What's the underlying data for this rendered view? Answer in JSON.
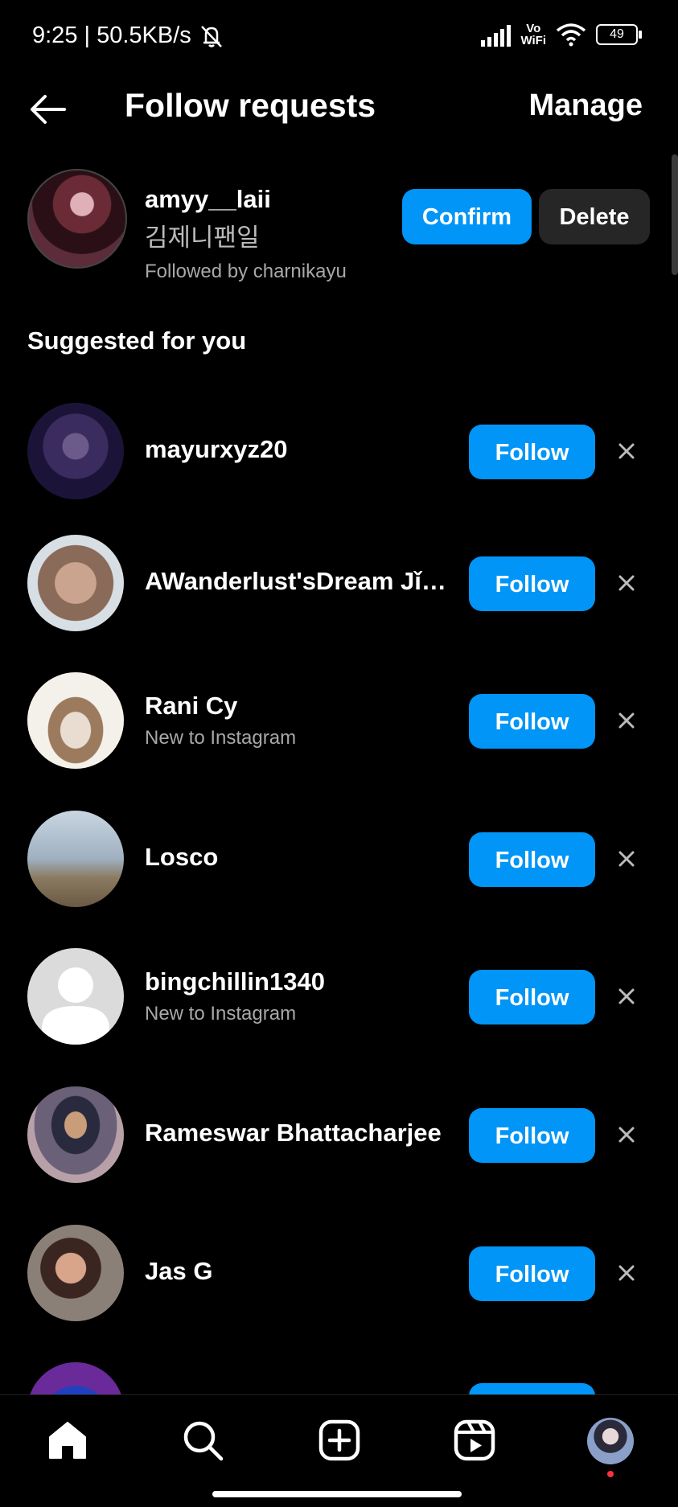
{
  "status_bar": {
    "time_speed": "9:25 | 50.5KB/s",
    "vowifi_top": "Vo",
    "vowifi_bottom": "WiFi",
    "battery": "49"
  },
  "header": {
    "title": "Follow requests",
    "manage_label": "Manage"
  },
  "request": {
    "username": "amyy__laii",
    "display_name": "김제니팬일",
    "followed_by": "Followed by charnikayu",
    "confirm_label": "Confirm",
    "delete_label": "Delete"
  },
  "suggested_heading": "Suggested for you",
  "suggestions": [
    {
      "name": "mayurxyz20",
      "subtitle": "",
      "follow_label": "Follow"
    },
    {
      "name": "AWanderlust'sDream Jǐmǐ...",
      "subtitle": "",
      "follow_label": "Follow"
    },
    {
      "name": "Rani Cy",
      "subtitle": "New to Instagram",
      "follow_label": "Follow"
    },
    {
      "name": "Losco",
      "subtitle": "",
      "follow_label": "Follow"
    },
    {
      "name": "bingchillin1340",
      "subtitle": "New to Instagram",
      "follow_label": "Follow"
    },
    {
      "name": "Rameswar Bhattacharjee",
      "subtitle": "",
      "follow_label": "Follow"
    },
    {
      "name": "Jas G",
      "subtitle": "",
      "follow_label": "Follow"
    }
  ],
  "bottom_nav": [
    "home-icon",
    "search-icon",
    "create-icon",
    "reels-icon",
    "profile-avatar"
  ],
  "colors": {
    "accent": "#0095f6",
    "background": "#000000",
    "secondary_button": "#262626",
    "notification_dot": "#ff3040"
  }
}
